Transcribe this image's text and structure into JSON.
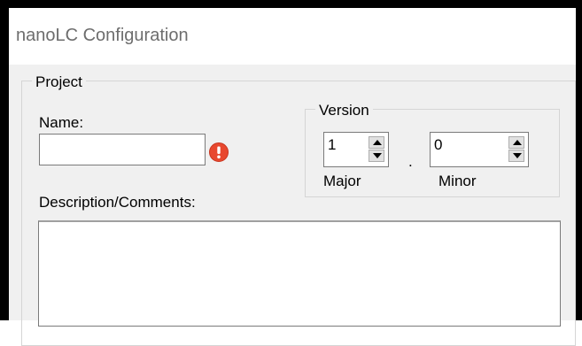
{
  "window": {
    "title": "nanoLC Configuration"
  },
  "project": {
    "legend": "Project",
    "name_label": "Name:",
    "name_value": "",
    "description_label": "Description/Comments:",
    "description_value": ""
  },
  "version": {
    "legend": "Version",
    "major_value": "1",
    "major_label": "Major",
    "separator": ".",
    "minor_value": "0",
    "minor_label": "Minor"
  },
  "icons": {
    "error": "exclamation-error-icon",
    "spin_up": "triangle-up-icon",
    "spin_down": "triangle-down-icon"
  },
  "colors": {
    "error_icon": "#e8482f",
    "title_text": "#6d6d6d",
    "client_bg": "#f0f0f0"
  }
}
